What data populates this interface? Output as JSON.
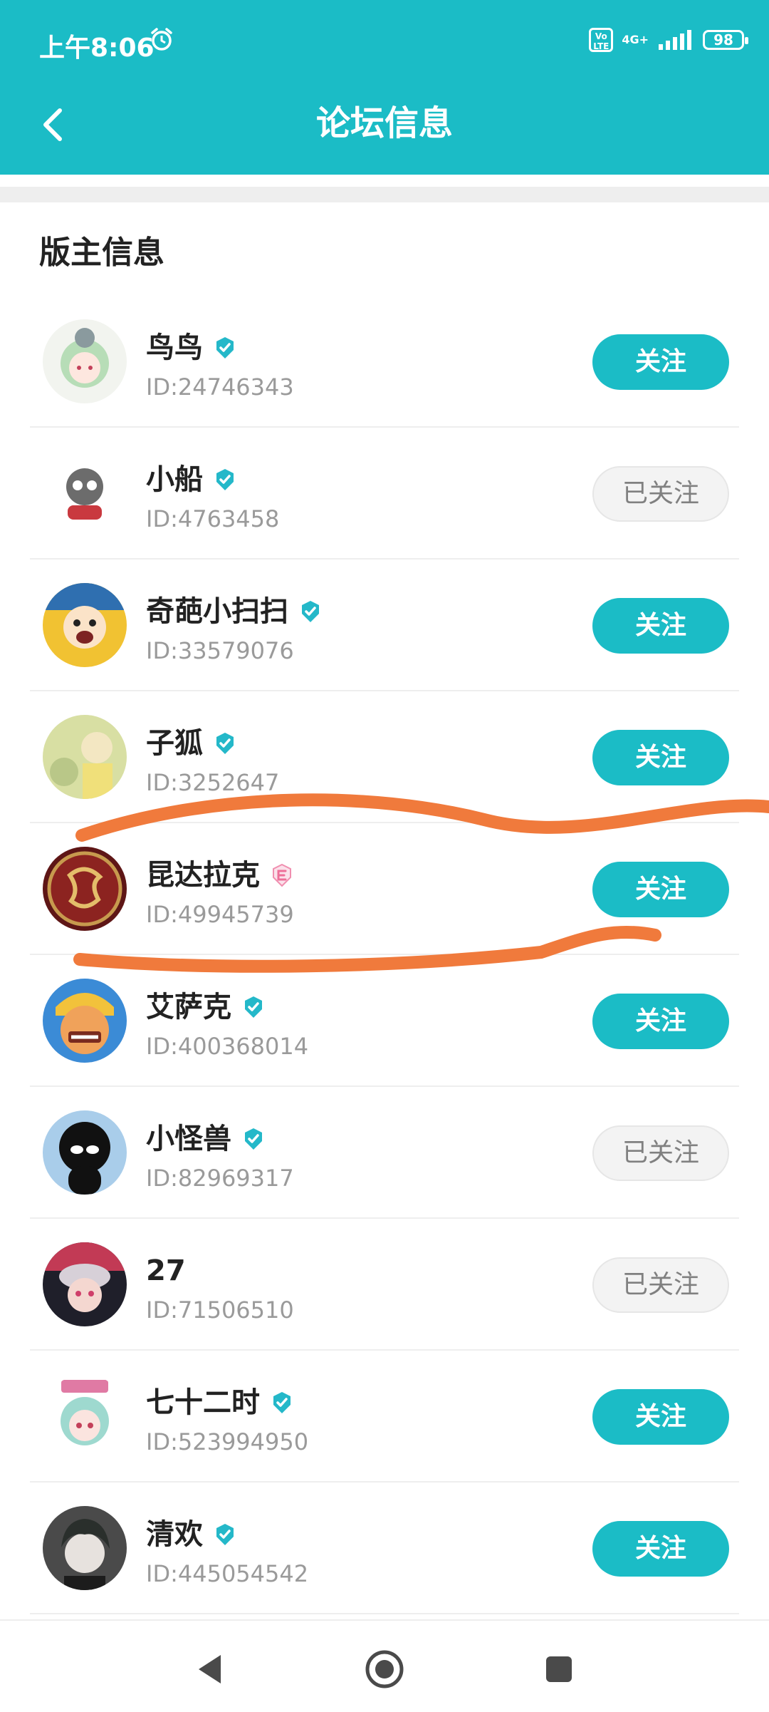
{
  "status_bar": {
    "time": "上午8:06",
    "volte": "Vo LTE",
    "network": "4G+",
    "battery": "98"
  },
  "header": {
    "title": "论坛信息"
  },
  "section": {
    "title": "版主信息"
  },
  "moderators": [
    {
      "name": "鸟鸟",
      "id": "ID:24746343",
      "button": "关注",
      "badge": "verified-icon"
    },
    {
      "name": "小船",
      "id": "ID:4763458",
      "button": "已关注",
      "badge": "verified-icon"
    },
    {
      "name": "奇葩小扫扫",
      "id": "ID:33579076",
      "button": "关注",
      "badge": "verified-icon"
    },
    {
      "name": "子狐",
      "id": "ID:3252647",
      "button": "关注",
      "badge": "verified-icon"
    },
    {
      "name": "昆达拉克",
      "id": "ID:49945739",
      "button": "关注",
      "badge": "pink-e-icon"
    },
    {
      "name": "艾萨克",
      "id": "ID:400368014",
      "button": "关注",
      "badge": "verified-icon"
    },
    {
      "name": "小怪兽",
      "id": "ID:82969317",
      "button": "已关注",
      "badge": "verified-icon"
    },
    {
      "name": "27",
      "id": "ID:71506510",
      "button": "已关注",
      "badge": ""
    },
    {
      "name": "七十二时",
      "id": "ID:523994950",
      "button": "关注",
      "badge": "verified-icon"
    },
    {
      "name": "清欢",
      "id": "ID:445054542",
      "button": "关注",
      "badge": "verified-icon"
    }
  ],
  "colors": {
    "accent": "#1bbcc6",
    "annotation": "#f07a3c",
    "followed_bg": "#f3f3f3"
  },
  "icons": {
    "back": "back-arrow-icon",
    "alarm": "alarm-icon",
    "nav_back": "nav-back-icon",
    "nav_home": "nav-home-icon",
    "nav_recent": "nav-recent-icon"
  }
}
